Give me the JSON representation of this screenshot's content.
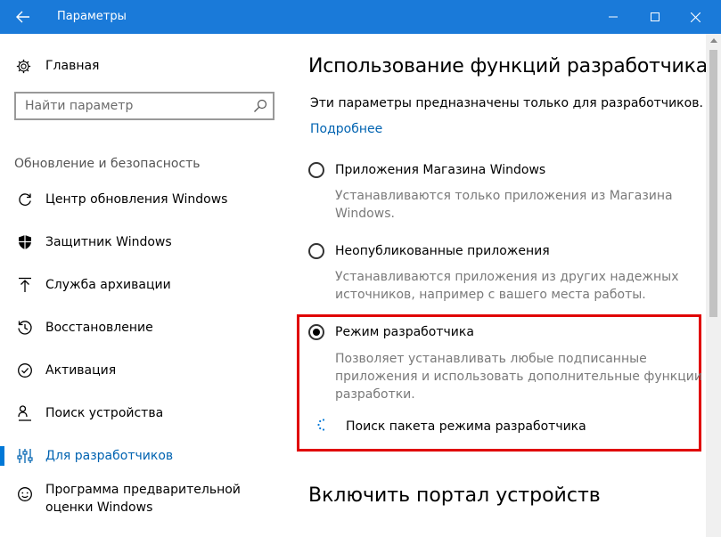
{
  "window": {
    "title": "Параметры"
  },
  "sidebar": {
    "home_label": "Главная",
    "search_placeholder": "Найти параметр",
    "section_heading": "Обновление и безопасность",
    "items": [
      {
        "label": "Центр обновления Windows",
        "icon": "refresh-icon"
      },
      {
        "label": "Защитник Windows",
        "icon": "shield-icon"
      },
      {
        "label": "Служба архивации",
        "icon": "backup-arrow-icon"
      },
      {
        "label": "Восстановление",
        "icon": "history-icon"
      },
      {
        "label": "Активация",
        "icon": "check-circle-icon"
      },
      {
        "label": "Поиск устройства",
        "icon": "person-pin-icon"
      },
      {
        "label": "Для разработчиков",
        "icon": "developer-tools-icon",
        "active": true
      },
      {
        "label": "Программа предварительной оценки Windows",
        "icon": "insider-face-icon"
      }
    ]
  },
  "main": {
    "title": "Использование функций разработчика",
    "description": "Эти параметры предназначены только для разработчиков.",
    "more_link": "Подробнее",
    "options": [
      {
        "label": "Приложения Магазина Windows",
        "sub_lines": [
          "Устанавливаются только приложения из Магазина",
          "Windows."
        ],
        "selected": false
      },
      {
        "label": "Неопубликованные приложения",
        "sub_lines": [
          "Устанавливаются приложения из других надежных",
          "источников, например с вашего места работы."
        ],
        "selected": false
      },
      {
        "label": "Режим разработчика",
        "sub_lines": [
          "Позволяет устанавливать любые подписанные",
          "приложения и использовать дополнительные функции",
          "разработки."
        ],
        "selected": true
      }
    ],
    "status_text": "Поиск пакета режима разработчика",
    "section2_title": "Включить портал устройств"
  },
  "colors": {
    "titlebar": "#1a7ad9",
    "accent": "#0078d7",
    "link": "#0063b1",
    "highlight_box": "#e00000"
  }
}
